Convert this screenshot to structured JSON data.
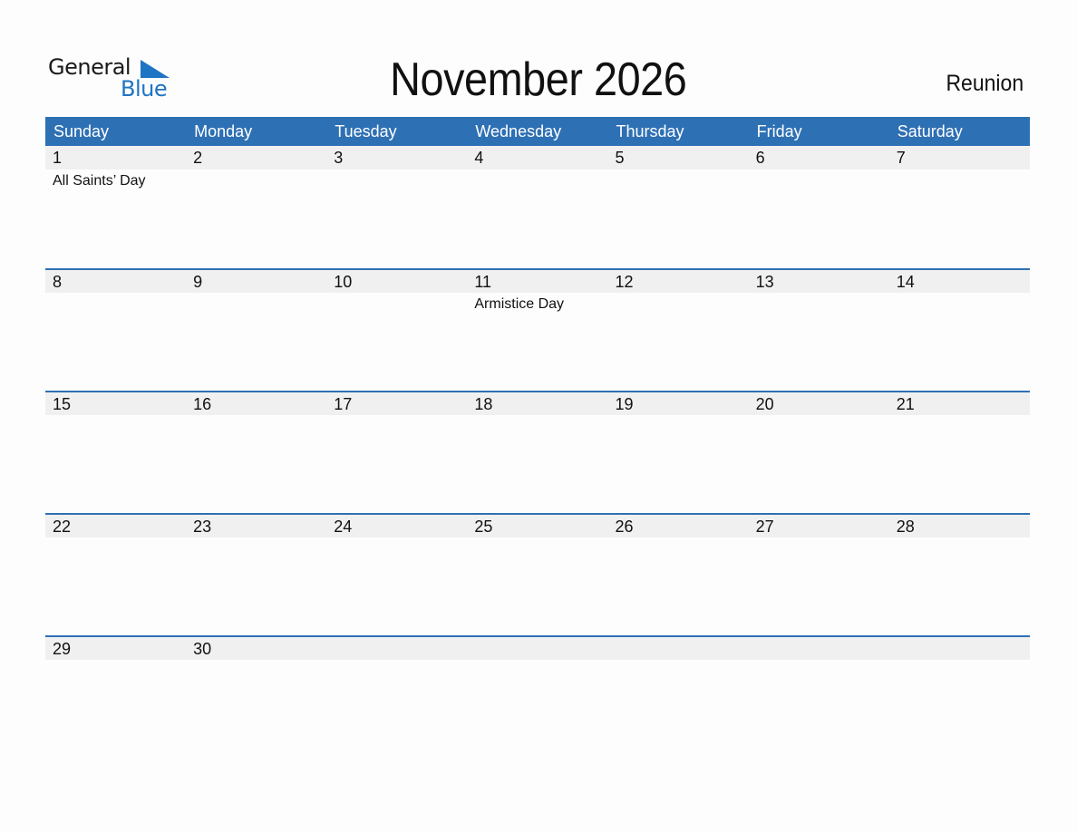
{
  "logo": {
    "general": "General",
    "blue": "Blue"
  },
  "title": "November 2026",
  "region": "Reunion",
  "colors": {
    "header_bg": "#2e70b4",
    "strip_bg": "#f0f0f0",
    "logo_blue": "#1f74c4"
  },
  "weekdays": [
    "Sunday",
    "Monday",
    "Tuesday",
    "Wednesday",
    "Thursday",
    "Friday",
    "Saturday"
  ],
  "weeks": [
    {
      "days": [
        "1",
        "2",
        "3",
        "4",
        "5",
        "6",
        "7"
      ],
      "events": [
        "All Saints’ Day",
        "",
        "",
        "",
        "",
        "",
        ""
      ]
    },
    {
      "days": [
        "8",
        "9",
        "10",
        "11",
        "12",
        "13",
        "14"
      ],
      "events": [
        "",
        "",
        "",
        "Armistice Day",
        "",
        "",
        ""
      ]
    },
    {
      "days": [
        "15",
        "16",
        "17",
        "18",
        "19",
        "20",
        "21"
      ],
      "events": [
        "",
        "",
        "",
        "",
        "",
        "",
        ""
      ]
    },
    {
      "days": [
        "22",
        "23",
        "24",
        "25",
        "26",
        "27",
        "28"
      ],
      "events": [
        "",
        "",
        "",
        "",
        "",
        "",
        ""
      ]
    },
    {
      "days": [
        "29",
        "30",
        "",
        "",
        "",
        "",
        ""
      ],
      "events": [
        "",
        "",
        "",
        "",
        "",
        "",
        ""
      ]
    }
  ]
}
